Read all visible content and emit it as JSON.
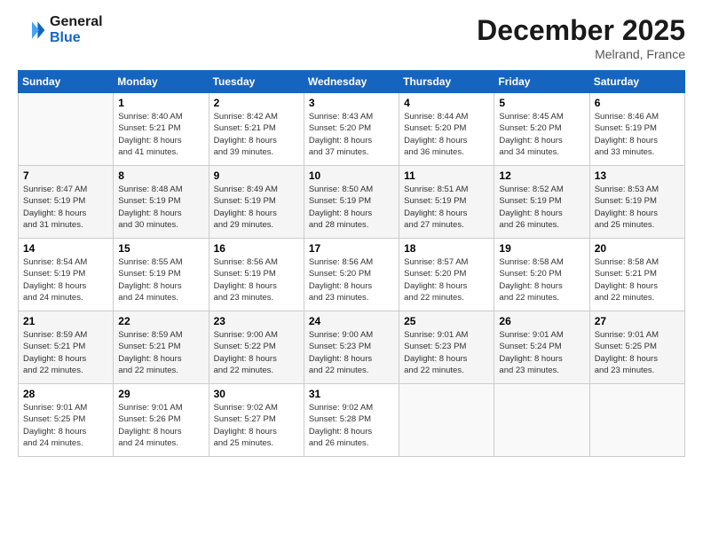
{
  "header": {
    "logo_line1": "General",
    "logo_line2": "Blue",
    "month": "December 2025",
    "location": "Melrand, France"
  },
  "weekdays": [
    "Sunday",
    "Monday",
    "Tuesday",
    "Wednesday",
    "Thursday",
    "Friday",
    "Saturday"
  ],
  "weeks": [
    [
      {
        "day": "",
        "info": ""
      },
      {
        "day": "1",
        "info": "Sunrise: 8:40 AM\nSunset: 5:21 PM\nDaylight: 8 hours\nand 41 minutes."
      },
      {
        "day": "2",
        "info": "Sunrise: 8:42 AM\nSunset: 5:21 PM\nDaylight: 8 hours\nand 39 minutes."
      },
      {
        "day": "3",
        "info": "Sunrise: 8:43 AM\nSunset: 5:20 PM\nDaylight: 8 hours\nand 37 minutes."
      },
      {
        "day": "4",
        "info": "Sunrise: 8:44 AM\nSunset: 5:20 PM\nDaylight: 8 hours\nand 36 minutes."
      },
      {
        "day": "5",
        "info": "Sunrise: 8:45 AM\nSunset: 5:20 PM\nDaylight: 8 hours\nand 34 minutes."
      },
      {
        "day": "6",
        "info": "Sunrise: 8:46 AM\nSunset: 5:19 PM\nDaylight: 8 hours\nand 33 minutes."
      }
    ],
    [
      {
        "day": "7",
        "info": "Sunrise: 8:47 AM\nSunset: 5:19 PM\nDaylight: 8 hours\nand 31 minutes."
      },
      {
        "day": "8",
        "info": "Sunrise: 8:48 AM\nSunset: 5:19 PM\nDaylight: 8 hours\nand 30 minutes."
      },
      {
        "day": "9",
        "info": "Sunrise: 8:49 AM\nSunset: 5:19 PM\nDaylight: 8 hours\nand 29 minutes."
      },
      {
        "day": "10",
        "info": "Sunrise: 8:50 AM\nSunset: 5:19 PM\nDaylight: 8 hours\nand 28 minutes."
      },
      {
        "day": "11",
        "info": "Sunrise: 8:51 AM\nSunset: 5:19 PM\nDaylight: 8 hours\nand 27 minutes."
      },
      {
        "day": "12",
        "info": "Sunrise: 8:52 AM\nSunset: 5:19 PM\nDaylight: 8 hours\nand 26 minutes."
      },
      {
        "day": "13",
        "info": "Sunrise: 8:53 AM\nSunset: 5:19 PM\nDaylight: 8 hours\nand 25 minutes."
      }
    ],
    [
      {
        "day": "14",
        "info": "Sunrise: 8:54 AM\nSunset: 5:19 PM\nDaylight: 8 hours\nand 24 minutes."
      },
      {
        "day": "15",
        "info": "Sunrise: 8:55 AM\nSunset: 5:19 PM\nDaylight: 8 hours\nand 24 minutes."
      },
      {
        "day": "16",
        "info": "Sunrise: 8:56 AM\nSunset: 5:19 PM\nDaylight: 8 hours\nand 23 minutes."
      },
      {
        "day": "17",
        "info": "Sunrise: 8:56 AM\nSunset: 5:20 PM\nDaylight: 8 hours\nand 23 minutes."
      },
      {
        "day": "18",
        "info": "Sunrise: 8:57 AM\nSunset: 5:20 PM\nDaylight: 8 hours\nand 22 minutes."
      },
      {
        "day": "19",
        "info": "Sunrise: 8:58 AM\nSunset: 5:20 PM\nDaylight: 8 hours\nand 22 minutes."
      },
      {
        "day": "20",
        "info": "Sunrise: 8:58 AM\nSunset: 5:21 PM\nDaylight: 8 hours\nand 22 minutes."
      }
    ],
    [
      {
        "day": "21",
        "info": "Sunrise: 8:59 AM\nSunset: 5:21 PM\nDaylight: 8 hours\nand 22 minutes."
      },
      {
        "day": "22",
        "info": "Sunrise: 8:59 AM\nSunset: 5:21 PM\nDaylight: 8 hours\nand 22 minutes."
      },
      {
        "day": "23",
        "info": "Sunrise: 9:00 AM\nSunset: 5:22 PM\nDaylight: 8 hours\nand 22 minutes."
      },
      {
        "day": "24",
        "info": "Sunrise: 9:00 AM\nSunset: 5:23 PM\nDaylight: 8 hours\nand 22 minutes."
      },
      {
        "day": "25",
        "info": "Sunrise: 9:01 AM\nSunset: 5:23 PM\nDaylight: 8 hours\nand 22 minutes."
      },
      {
        "day": "26",
        "info": "Sunrise: 9:01 AM\nSunset: 5:24 PM\nDaylight: 8 hours\nand 23 minutes."
      },
      {
        "day": "27",
        "info": "Sunrise: 9:01 AM\nSunset: 5:25 PM\nDaylight: 8 hours\nand 23 minutes."
      }
    ],
    [
      {
        "day": "28",
        "info": "Sunrise: 9:01 AM\nSunset: 5:25 PM\nDaylight: 8 hours\nand 24 minutes."
      },
      {
        "day": "29",
        "info": "Sunrise: 9:01 AM\nSunset: 5:26 PM\nDaylight: 8 hours\nand 24 minutes."
      },
      {
        "day": "30",
        "info": "Sunrise: 9:02 AM\nSunset: 5:27 PM\nDaylight: 8 hours\nand 25 minutes."
      },
      {
        "day": "31",
        "info": "Sunrise: 9:02 AM\nSunset: 5:28 PM\nDaylight: 8 hours\nand 26 minutes."
      },
      {
        "day": "",
        "info": ""
      },
      {
        "day": "",
        "info": ""
      },
      {
        "day": "",
        "info": ""
      }
    ]
  ]
}
